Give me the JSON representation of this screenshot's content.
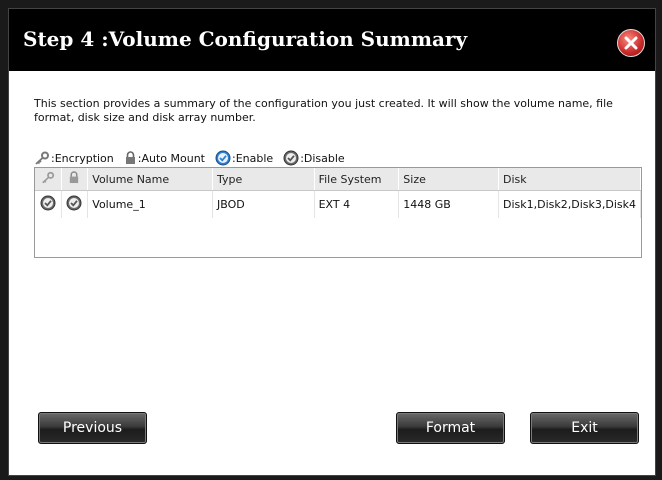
{
  "dialog": {
    "title": "Step 4 :Volume Configuration Summary",
    "description": "This section provides a summary of the configuration you just created. It will show the volume name, file format, disk size and disk array number."
  },
  "legend": {
    "encryption_label": ":Encryption",
    "automount_label": ":Auto Mount",
    "enable_label": ":Enable",
    "disable_label": ":Disable"
  },
  "table": {
    "columns": [
      "",
      "",
      "Volume Name",
      "Type",
      "File System",
      "Size",
      "Disk"
    ],
    "rows": [
      {
        "encryption": "disable",
        "auto_mount": "disable",
        "volume_name": "Volume_1",
        "type": "JBOD",
        "file_system": "EXT 4",
        "size": "1448 GB",
        "disk": "Disk1,Disk2,Disk3,Disk4"
      }
    ]
  },
  "buttons": {
    "previous": "Previous",
    "format": "Format",
    "exit": "Exit"
  },
  "icons": {
    "close": "close-icon",
    "encryption": "key-icon",
    "auto_mount": "lock-icon",
    "enable": "check-circle-blue-icon",
    "disable": "check-circle-gray-icon"
  },
  "colors": {
    "title_bar": "#000000",
    "close_button": "#c62828",
    "enable": "#2f7fd0",
    "disable": "#666666"
  }
}
